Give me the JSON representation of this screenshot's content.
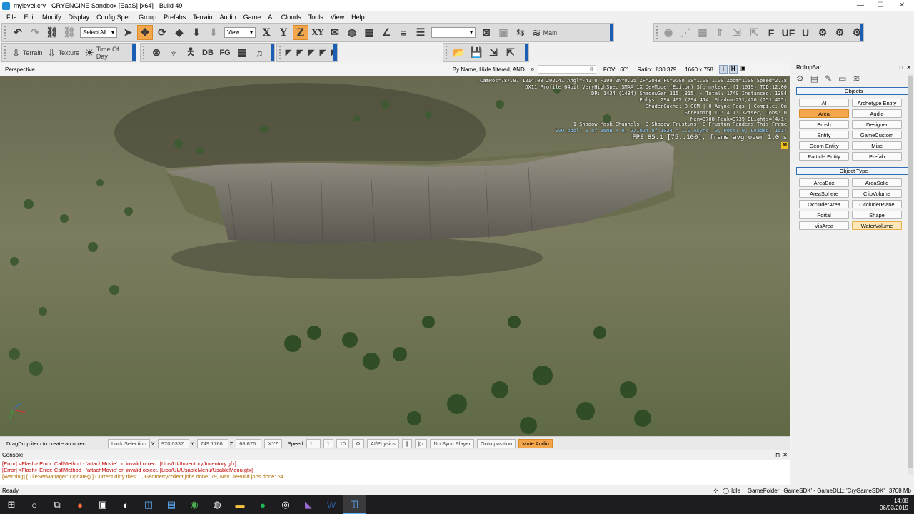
{
  "window": {
    "title": "mylevel.cry - CRYENGINE Sandbox [EaaS] [x64] - Build 49",
    "min": "—",
    "max": "☐",
    "close": "✕"
  },
  "menu": [
    "File",
    "Edit",
    "Modify",
    "Display",
    "Config Spec",
    "Group",
    "Prefabs",
    "Terrain",
    "Audio",
    "Game",
    "AI",
    "Clouds",
    "Tools",
    "View",
    "Help"
  ],
  "toolbar1": {
    "select_all": "Select All",
    "view_mode": "View",
    "axis_x": "X",
    "axis_y": "Y",
    "axis_z": "Z",
    "axis_xy": "XY",
    "main_label": "Main"
  },
  "toolbar2": {
    "terrain": "Terrain",
    "texture": "Texture",
    "time_of_day": "Time Of Day",
    "db": "DB",
    "fg": "FG"
  },
  "viewport_header": {
    "mode": "Perspective",
    "filter": "By Name, Hide filtered, AND",
    "fov_label": "FOV:",
    "fov": "60°",
    "ratio_label": "Ratio:",
    "ratio": "830:379",
    "resolution": "1660 x 758",
    "btn_i": "i",
    "btn_h": "H"
  },
  "debug": [
    "CamPos=787.97 1214.08 202.41 Angl=-41  0 -109 ZN=0.25 ZF=2048 FC=0.00 VS=1.00,1.00 Zoom=1.00 Speed=2.78",
    "DX11 Profile 64bit VeryHighSpec SMAA 1X DevMode (Editor) Sf: mylevel (1.1019) TOD:12.00",
    "DP: 1434 (1434) ShadowGen:315 (315) - Total: 1749 Instanced: 1384",
    "Polys: 294,402 (294,414) Shadow:251,426 (251,425)",
    "ShaderCache: 0 GCM | 0 Async Reqs | Compile: On",
    "Streaming IO: ACT: 32msec, Jobs: 0",
    "Mem=3708 Peak=3739 DLights=(4/1)",
    "1 Shadow Mask Channels,  0 Shadow Frustums,  0 Frustum Renders This Frame",
    "SVO pool: 1 of 16MB x 0,  2/1024 of 1024 = 1.0 Async: 0, Post: 0, Loaded: 1517",
    "FPS 85.1 [75..100], frame avg over 1.0 s"
  ],
  "statusrow": {
    "hint": "DragDrop item to create an object",
    "lock": "Lock Selection",
    "x_label": "X:",
    "x": "970.0337",
    "y_label": "Y:",
    "y": "749.1768",
    "z_label": "Z:",
    "z": "68.676",
    "xyz": "XYZ",
    "speed_label": "Speed:",
    "speed": "1",
    "s1": "1",
    "s2": "10",
    "ai_physics": "AI/Physics",
    "no_sync": "No Sync Player",
    "goto": "Goto position",
    "mute": "Mute Audio"
  },
  "console": {
    "title": "Console",
    "lines": [
      {
        "text": "[Error] <Flash> Error: CallMethod - 'attachMovie' on invalid object. [Libs/UI//Inventory/Inventory.gfx]",
        "color": "#c00000"
      },
      {
        "text": "[Error] <Flash> Error: CallMethod - 'attachMovie' on invalid object. [Libs/UI//UsableMenu/UsableMenu.gfx]",
        "color": "#c00000"
      },
      {
        "text": "[Warning] [ TileSetManager::Update() ] Current dirty tiles: 0, Geometrycollect jobs done: 79, NavTileBuild jobs done: 64",
        "color": "#b36b00"
      }
    ]
  },
  "statusbar": {
    "left": "Ready",
    "idle": "Idle",
    "game": "GameFolder: 'GameSDK' - GameDLL: 'CryGameSDK'",
    "mem": "3708 Mb",
    "time": "14:08",
    "date": "06/03/2019"
  },
  "rollup": {
    "title": "RollupBar",
    "objects_header": "Objects",
    "objects": [
      {
        "label": "AI",
        "state": ""
      },
      {
        "label": "Archetype Entity",
        "state": ""
      },
      {
        "label": "Area",
        "state": "sel"
      },
      {
        "label": "Audio",
        "state": ""
      },
      {
        "label": "Brush",
        "state": ""
      },
      {
        "label": "Designer",
        "state": ""
      },
      {
        "label": "Entity",
        "state": ""
      },
      {
        "label": "GameCustom",
        "state": ""
      },
      {
        "label": "Geom Entity",
        "state": ""
      },
      {
        "label": "Misc",
        "state": ""
      },
      {
        "label": "Particle Entity",
        "state": ""
      },
      {
        "label": "Prefab",
        "state": ""
      }
    ],
    "type_header": "Object Type",
    "types": [
      {
        "label": "AreaBox",
        "state": ""
      },
      {
        "label": "AreaSolid",
        "state": ""
      },
      {
        "label": "AreaSphere",
        "state": ""
      },
      {
        "label": "ClipVolume",
        "state": ""
      },
      {
        "label": "OccluderArea",
        "state": ""
      },
      {
        "label": "OccluderPlane",
        "state": ""
      },
      {
        "label": "Portal",
        "state": ""
      },
      {
        "label": "Shape",
        "state": ""
      },
      {
        "label": "VisArea",
        "state": ""
      },
      {
        "label": "WaterVolume",
        "state": "hover"
      }
    ]
  },
  "colors": {
    "accent": "#f3a64b",
    "blue": "#2f6db5"
  }
}
